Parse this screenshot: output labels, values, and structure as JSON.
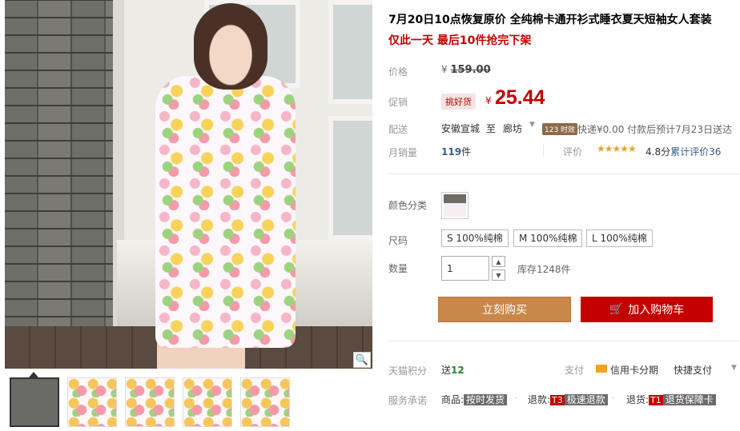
{
  "product": {
    "title": "7月20日10点恢复原价 全纯棉卡通开衫式睡衣夏天短袖女人套装",
    "subtitle": "仅此一天 最后10件抢完下架"
  },
  "price": {
    "label": "价格",
    "currency": "¥",
    "original": "159.00"
  },
  "promo": {
    "label": "促销",
    "badge": "挑好货",
    "currency": "¥",
    "price": "25.44"
  },
  "shipping": {
    "label": "配送",
    "from": "安徽宣城",
    "to_word": "至",
    "destination": "廊坊",
    "time_badge": "123 时效",
    "detail": "快递¥0.00 付款后预计7月23日送达"
  },
  "sales": {
    "label": "月销量",
    "count": "119",
    "unit": "件",
    "review_label": "评价",
    "stars": "★★★★★",
    "score": "4.8分",
    "review_text": "累计评价",
    "review_count": "36"
  },
  "color": {
    "label": "颜色分类"
  },
  "size": {
    "label": "尺码",
    "options": [
      "S 100%纯棉",
      "M 100%纯棉",
      "L 100%纯棉"
    ]
  },
  "quantity": {
    "label": "数量",
    "value": "1",
    "up": "▲",
    "down": "▼",
    "stock": "库存1248件"
  },
  "actions": {
    "buy_now": "立刻购买",
    "add_cart": "加入购物车"
  },
  "points": {
    "label": "天猫积分",
    "prefix": "送",
    "value": "12"
  },
  "payment": {
    "label": "支付",
    "card": "信用卡分期",
    "quick": "快捷支付"
  },
  "service": {
    "label": "服务承诺",
    "goods_label": "商品:",
    "goods_tag": "按时发货",
    "refund_label": "退款:",
    "refund_code": "T3",
    "refund_tag": "极速退款",
    "return_label": "退货:",
    "return_code": "T1",
    "return_tag": "退货保障卡"
  },
  "colors": {
    "accent_red": "#c40000",
    "buy_orange": "#c9874a",
    "link_blue": "#3a5b8c",
    "points_green": "#1a8a2e"
  },
  "icons": {
    "zoom": "magnifier-icon",
    "cart": "cart-icon",
    "card": "credit-card-icon"
  }
}
